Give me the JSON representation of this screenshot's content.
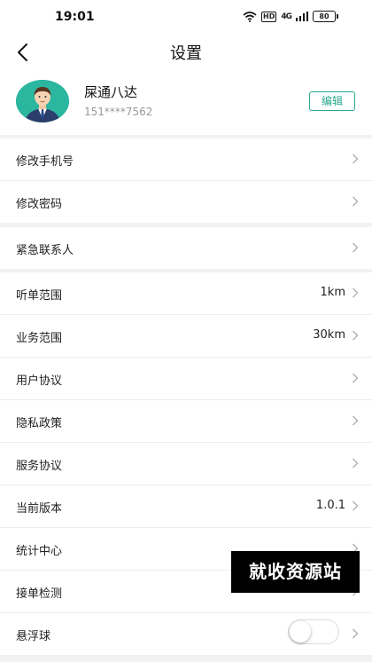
{
  "status_bar": {
    "time": "19:01",
    "network_badge": "HD",
    "signal_text": "4G",
    "battery_level": "80"
  },
  "header": {
    "title": "设置"
  },
  "profile": {
    "name": "屎通八达",
    "phone": "151****7562",
    "edit_label": "编辑"
  },
  "groups": [
    {
      "items": [
        {
          "label": "修改手机号"
        },
        {
          "label": "修改密码"
        }
      ]
    },
    {
      "items": [
        {
          "label": "紧急联系人"
        }
      ]
    },
    {
      "items": [
        {
          "label": "听单范围",
          "value": "1km"
        },
        {
          "label": "业务范围",
          "value": "30km"
        },
        {
          "label": "用户协议"
        },
        {
          "label": "隐私政策"
        },
        {
          "label": "服务协议"
        },
        {
          "label": "当前版本",
          "value": "1.0.1"
        },
        {
          "label": "统计中心"
        },
        {
          "label": "接单检测"
        },
        {
          "label": "悬浮球",
          "toggle": false
        }
      ]
    }
  ],
  "watermark": "就收资源站",
  "colors": {
    "accent": "#26a88e",
    "background": "#f2f2f2"
  }
}
